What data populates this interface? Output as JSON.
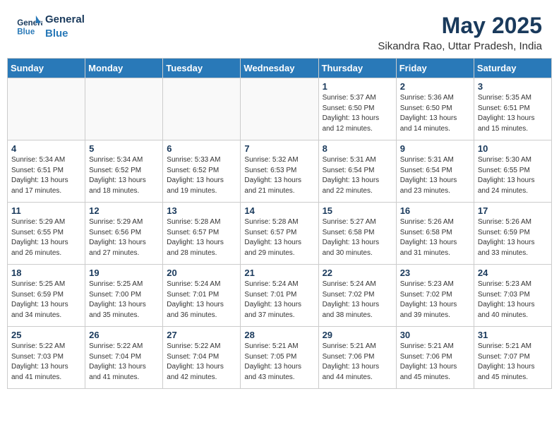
{
  "header": {
    "logo_line1": "General",
    "logo_line2": "Blue",
    "month": "May 2025",
    "location": "Sikandra Rao, Uttar Pradesh, India"
  },
  "weekdays": [
    "Sunday",
    "Monday",
    "Tuesday",
    "Wednesday",
    "Thursday",
    "Friday",
    "Saturday"
  ],
  "weeks": [
    [
      {
        "day": "",
        "info": ""
      },
      {
        "day": "",
        "info": ""
      },
      {
        "day": "",
        "info": ""
      },
      {
        "day": "",
        "info": ""
      },
      {
        "day": "1",
        "info": "Sunrise: 5:37 AM\nSunset: 6:50 PM\nDaylight: 13 hours\nand 12 minutes."
      },
      {
        "day": "2",
        "info": "Sunrise: 5:36 AM\nSunset: 6:50 PM\nDaylight: 13 hours\nand 14 minutes."
      },
      {
        "day": "3",
        "info": "Sunrise: 5:35 AM\nSunset: 6:51 PM\nDaylight: 13 hours\nand 15 minutes."
      }
    ],
    [
      {
        "day": "4",
        "info": "Sunrise: 5:34 AM\nSunset: 6:51 PM\nDaylight: 13 hours\nand 17 minutes."
      },
      {
        "day": "5",
        "info": "Sunrise: 5:34 AM\nSunset: 6:52 PM\nDaylight: 13 hours\nand 18 minutes."
      },
      {
        "day": "6",
        "info": "Sunrise: 5:33 AM\nSunset: 6:52 PM\nDaylight: 13 hours\nand 19 minutes."
      },
      {
        "day": "7",
        "info": "Sunrise: 5:32 AM\nSunset: 6:53 PM\nDaylight: 13 hours\nand 21 minutes."
      },
      {
        "day": "8",
        "info": "Sunrise: 5:31 AM\nSunset: 6:54 PM\nDaylight: 13 hours\nand 22 minutes."
      },
      {
        "day": "9",
        "info": "Sunrise: 5:31 AM\nSunset: 6:54 PM\nDaylight: 13 hours\nand 23 minutes."
      },
      {
        "day": "10",
        "info": "Sunrise: 5:30 AM\nSunset: 6:55 PM\nDaylight: 13 hours\nand 24 minutes."
      }
    ],
    [
      {
        "day": "11",
        "info": "Sunrise: 5:29 AM\nSunset: 6:55 PM\nDaylight: 13 hours\nand 26 minutes."
      },
      {
        "day": "12",
        "info": "Sunrise: 5:29 AM\nSunset: 6:56 PM\nDaylight: 13 hours\nand 27 minutes."
      },
      {
        "day": "13",
        "info": "Sunrise: 5:28 AM\nSunset: 6:57 PM\nDaylight: 13 hours\nand 28 minutes."
      },
      {
        "day": "14",
        "info": "Sunrise: 5:28 AM\nSunset: 6:57 PM\nDaylight: 13 hours\nand 29 minutes."
      },
      {
        "day": "15",
        "info": "Sunrise: 5:27 AM\nSunset: 6:58 PM\nDaylight: 13 hours\nand 30 minutes."
      },
      {
        "day": "16",
        "info": "Sunrise: 5:26 AM\nSunset: 6:58 PM\nDaylight: 13 hours\nand 31 minutes."
      },
      {
        "day": "17",
        "info": "Sunrise: 5:26 AM\nSunset: 6:59 PM\nDaylight: 13 hours\nand 33 minutes."
      }
    ],
    [
      {
        "day": "18",
        "info": "Sunrise: 5:25 AM\nSunset: 6:59 PM\nDaylight: 13 hours\nand 34 minutes."
      },
      {
        "day": "19",
        "info": "Sunrise: 5:25 AM\nSunset: 7:00 PM\nDaylight: 13 hours\nand 35 minutes."
      },
      {
        "day": "20",
        "info": "Sunrise: 5:24 AM\nSunset: 7:01 PM\nDaylight: 13 hours\nand 36 minutes."
      },
      {
        "day": "21",
        "info": "Sunrise: 5:24 AM\nSunset: 7:01 PM\nDaylight: 13 hours\nand 37 minutes."
      },
      {
        "day": "22",
        "info": "Sunrise: 5:24 AM\nSunset: 7:02 PM\nDaylight: 13 hours\nand 38 minutes."
      },
      {
        "day": "23",
        "info": "Sunrise: 5:23 AM\nSunset: 7:02 PM\nDaylight: 13 hours\nand 39 minutes."
      },
      {
        "day": "24",
        "info": "Sunrise: 5:23 AM\nSunset: 7:03 PM\nDaylight: 13 hours\nand 40 minutes."
      }
    ],
    [
      {
        "day": "25",
        "info": "Sunrise: 5:22 AM\nSunset: 7:03 PM\nDaylight: 13 hours\nand 41 minutes."
      },
      {
        "day": "26",
        "info": "Sunrise: 5:22 AM\nSunset: 7:04 PM\nDaylight: 13 hours\nand 41 minutes."
      },
      {
        "day": "27",
        "info": "Sunrise: 5:22 AM\nSunset: 7:04 PM\nDaylight: 13 hours\nand 42 minutes."
      },
      {
        "day": "28",
        "info": "Sunrise: 5:21 AM\nSunset: 7:05 PM\nDaylight: 13 hours\nand 43 minutes."
      },
      {
        "day": "29",
        "info": "Sunrise: 5:21 AM\nSunset: 7:06 PM\nDaylight: 13 hours\nand 44 minutes."
      },
      {
        "day": "30",
        "info": "Sunrise: 5:21 AM\nSunset: 7:06 PM\nDaylight: 13 hours\nand 45 minutes."
      },
      {
        "day": "31",
        "info": "Sunrise: 5:21 AM\nSunset: 7:07 PM\nDaylight: 13 hours\nand 45 minutes."
      }
    ]
  ]
}
